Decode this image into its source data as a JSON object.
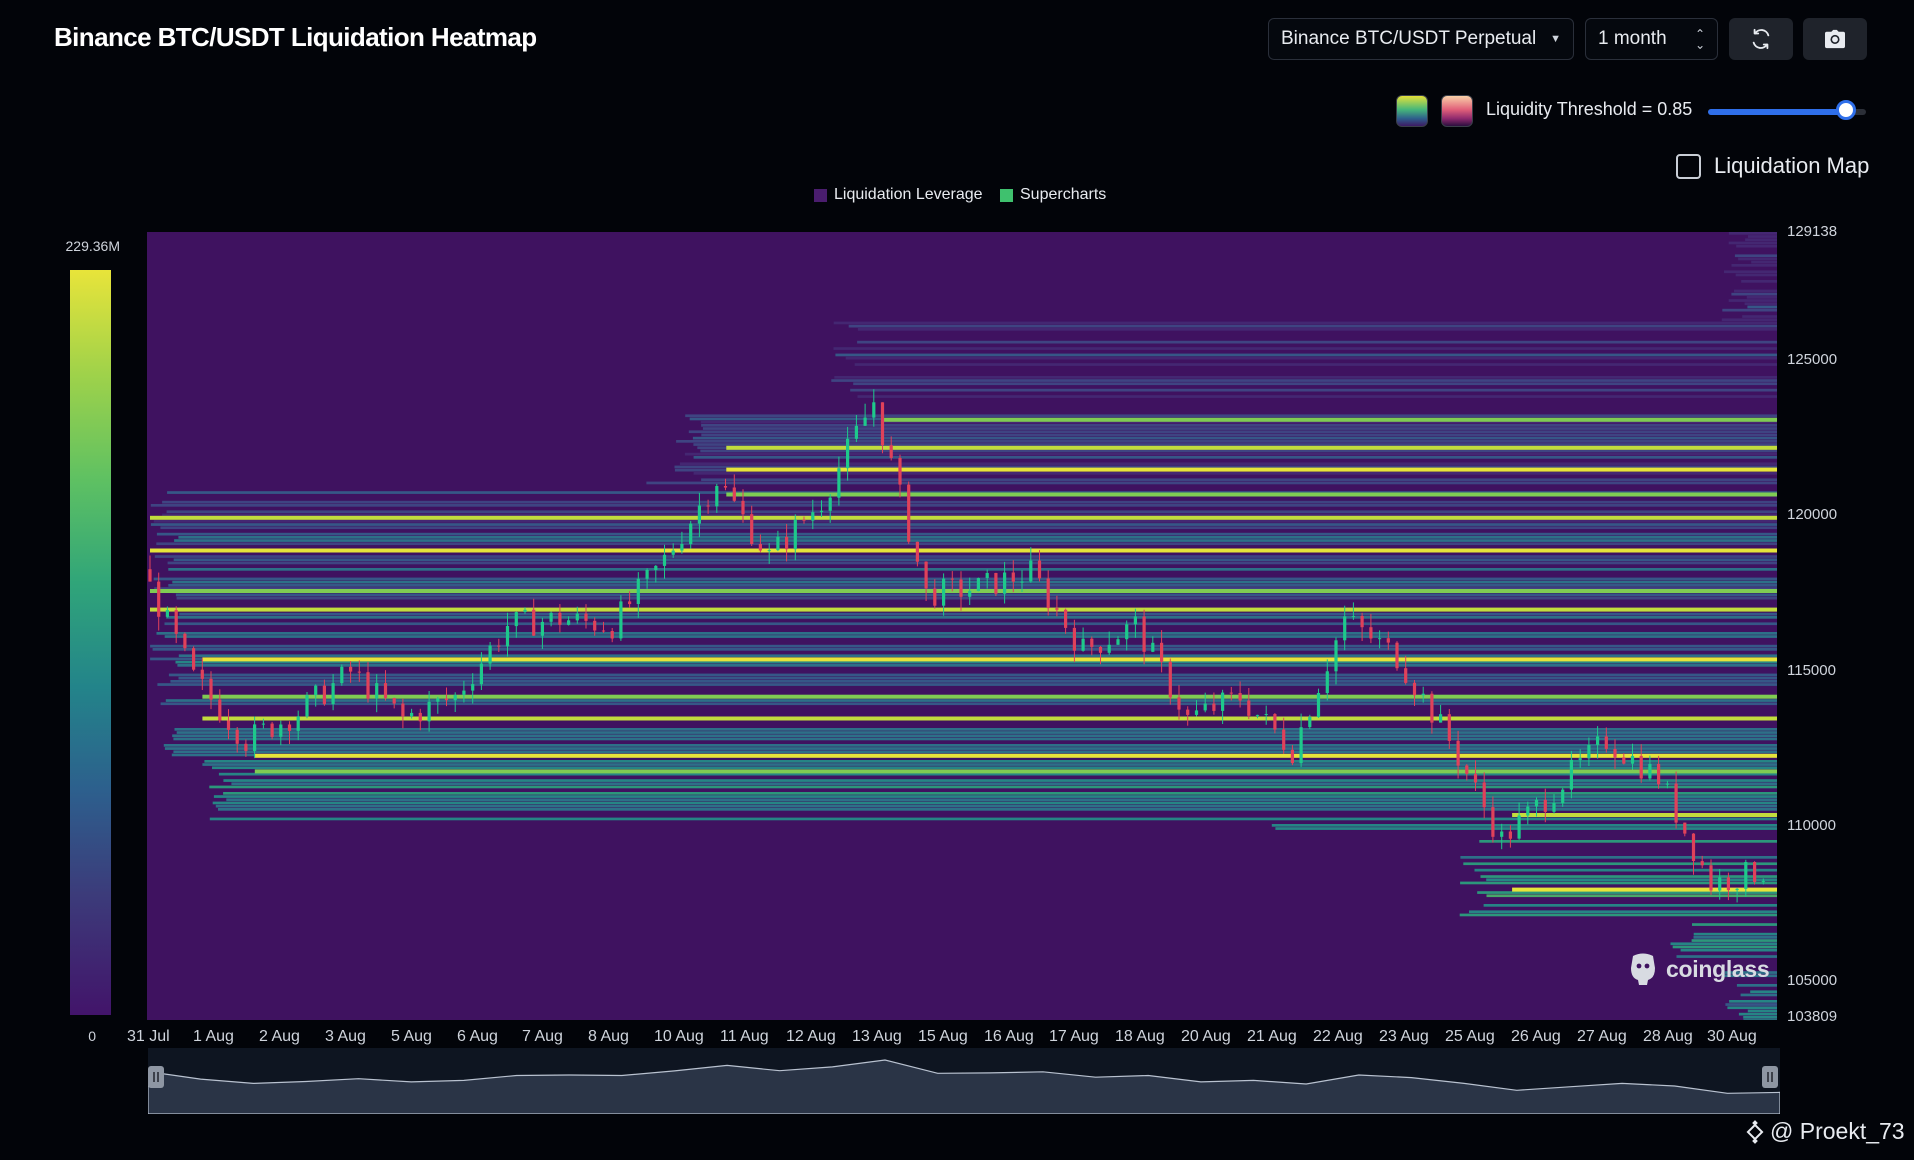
{
  "header": {
    "title": "Binance BTC/USDT Liquidation Heatmap",
    "pair_select": "Binance BTC/USDT Perpetual",
    "range_select": "1 month",
    "refresh_icon": "refresh-icon",
    "camera_icon": "camera-icon"
  },
  "controls": {
    "threshold_label": "Liquidity Threshold = 0.85",
    "threshold_value": 0.85,
    "liquidation_map_label": "Liquidation Map",
    "liquidation_map_checked": false
  },
  "legend": {
    "items": [
      {
        "label": "Liquidation Leverage",
        "color": "#4a1d6e"
      },
      {
        "label": "Supercharts",
        "color": "#3fc16e"
      }
    ]
  },
  "colorbar": {
    "max_label": "229.36M",
    "min_label": "0"
  },
  "y_axis": {
    "ticks": [
      "129138",
      "125000",
      "120000",
      "115000",
      "110000",
      "105000",
      "103809"
    ]
  },
  "x_axis": {
    "ticks": [
      "31 Jul",
      "1 Aug",
      "2 Aug",
      "3 Aug",
      "5 Aug",
      "6 Aug",
      "7 Aug",
      "8 Aug",
      "10 Aug",
      "11 Aug",
      "12 Aug",
      "13 Aug",
      "15 Aug",
      "16 Aug",
      "17 Aug",
      "18 Aug",
      "20 Aug",
      "21 Aug",
      "22 Aug",
      "23 Aug",
      "25 Aug",
      "26 Aug",
      "27 Aug",
      "28 Aug",
      "30 Aug"
    ]
  },
  "watermark": "coinglass",
  "credit": "@ Proekt_73",
  "colors": {
    "background": "#020409",
    "heatmap_base": "#3f1260",
    "accent": "#2f6fea",
    "candle_up": "#1ec98b",
    "candle_down": "#e0415a"
  },
  "chart_data": {
    "type": "heatmap",
    "title": "Binance BTC/USDT Liquidation Heatmap",
    "y_range": [
      103809,
      129138
    ],
    "x_range": [
      "31 Jul",
      "31 Aug"
    ],
    "colorscale_range": [
      0,
      229360000
    ],
    "price_path_approx": [
      {
        "date": "31 Jul",
        "close": 118300
      },
      {
        "date": "1 Aug",
        "close": 114800
      },
      {
        "date": "2 Aug",
        "close": 112800
      },
      {
        "date": "3 Aug",
        "close": 113700
      },
      {
        "date": "4 Aug",
        "close": 115000
      },
      {
        "date": "5 Aug",
        "close": 113500
      },
      {
        "date": "6 Aug",
        "close": 114200
      },
      {
        "date": "7 Aug",
        "close": 116500
      },
      {
        "date": "8 Aug",
        "close": 116700
      },
      {
        "date": "9 Aug",
        "close": 116500
      },
      {
        "date": "10 Aug",
        "close": 118600
      },
      {
        "date": "11 Aug",
        "close": 121200
      },
      {
        "date": "12 Aug",
        "close": 118700
      },
      {
        "date": "13 Aug",
        "close": 120500
      },
      {
        "date": "14 Aug",
        "close": 123700
      },
      {
        "date": "15 Aug",
        "close": 117500
      },
      {
        "date": "16 Aug",
        "close": 117700
      },
      {
        "date": "17 Aug",
        "close": 118200
      },
      {
        "date": "18 Aug",
        "close": 115700
      },
      {
        "date": "19 Aug",
        "close": 116500
      },
      {
        "date": "20 Aug",
        "close": 113500
      },
      {
        "date": "21 Aug",
        "close": 114200
      },
      {
        "date": "22 Aug",
        "close": 112500
      },
      {
        "date": "23 Aug",
        "close": 116700
      },
      {
        "date": "24 Aug",
        "close": 115500
      },
      {
        "date": "25 Aug",
        "close": 112800
      },
      {
        "date": "26 Aug",
        "close": 109600
      },
      {
        "date": "27 Aug",
        "close": 111200
      },
      {
        "date": "28 Aug",
        "close": 112800
      },
      {
        "date": "29 Aug",
        "close": 111600
      },
      {
        "date": "30 Aug",
        "close": 108200
      },
      {
        "date": "31 Aug",
        "close": 108600
      }
    ],
    "strong_liquidity_levels": [
      123100,
      122200,
      121500,
      120700,
      119950,
      118900,
      117600,
      117000,
      115400,
      114200,
      113500,
      112300,
      111800,
      110400,
      108000
    ]
  }
}
